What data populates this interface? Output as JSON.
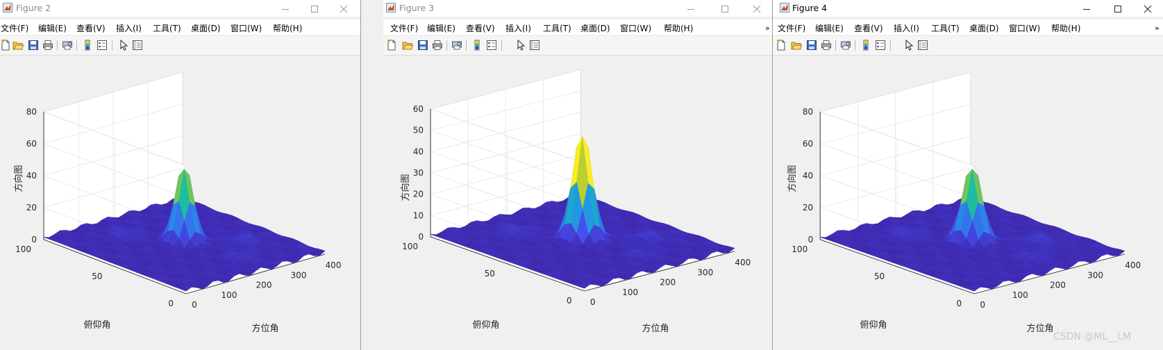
{
  "windows": [
    {
      "title": "Figure 2",
      "state": "inactive",
      "menu": [
        "文件(F)",
        "编辑(E)",
        "查看(V)",
        "插入(I)",
        "工具(T)",
        "桌面(D)",
        "窗口(W)",
        "帮助(H)"
      ],
      "plot": {
        "z_ticks": [
          "0",
          "20",
          "40",
          "60",
          "80"
        ],
        "x_ticks": [
          "0",
          "100",
          "200",
          "300",
          "400"
        ],
        "y_ticks": [
          "0",
          "50",
          "100"
        ],
        "z_label": "方向图",
        "x_label": "方位角",
        "y_label": "俯仰角"
      }
    },
    {
      "title": "Figure 3",
      "state": "inactive",
      "menu": [
        "文件(F)",
        "编辑(E)",
        "查看(V)",
        "插入(I)",
        "工具(T)",
        "桌面(D)",
        "窗口(W)",
        "帮助(H)"
      ],
      "plot": {
        "z_ticks": [
          "0",
          "10",
          "20",
          "30",
          "40",
          "50",
          "60"
        ],
        "x_ticks": [
          "0",
          "100",
          "200",
          "300",
          "400"
        ],
        "y_ticks": [
          "0",
          "50",
          "100"
        ],
        "z_label": "方向图",
        "x_label": "方位角",
        "y_label": "俯仰角"
      }
    },
    {
      "title": "Figure 4",
      "state": "active",
      "menu": [
        "文件(F)",
        "编辑(E)",
        "查看(V)",
        "插入(I)",
        "工具(T)",
        "桌面(D)",
        "窗口(W)",
        "帮助(H)"
      ],
      "plot": {
        "z_ticks": [
          "0",
          "20",
          "40",
          "60",
          "80"
        ],
        "x_ticks": [
          "0",
          "100",
          "200",
          "300",
          "400"
        ],
        "y_ticks": [
          "0",
          "50",
          "100"
        ],
        "z_label": "方向图",
        "x_label": "方位角",
        "y_label": "俯仰角"
      }
    }
  ],
  "toolbar_icons": [
    "new-figure-icon",
    "open-file-icon",
    "save-icon",
    "print-icon",
    "print-preview-icon",
    "colorbar-icon",
    "legend-icon",
    "pointer-icon",
    "property-editor-icon"
  ],
  "menu_overflow_glyph": "»",
  "watermark": "CSDN @ML__LM",
  "colors": {
    "surface_low": "#3e2ef0",
    "surface_peak": "#fde725",
    "mid": "#1fb8a0",
    "grid": "#e3e3e3",
    "axis_text": "#262626"
  }
}
